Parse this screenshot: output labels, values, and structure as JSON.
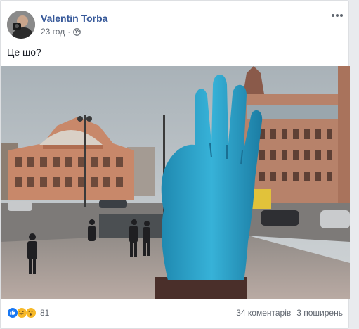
{
  "post": {
    "author": "Valentin Torba",
    "time": "23 год",
    "privacy_icon": "globe-icon",
    "text": "Це шо?"
  },
  "reactions": {
    "icons": [
      "like-icon",
      "haha-icon",
      "wow-icon"
    ],
    "count": "81"
  },
  "stats": {
    "comments": "34 коментарів",
    "shares": "3 поширень"
  },
  "colors": {
    "author_link": "#365899",
    "meta_text": "#616770",
    "like": "#1877f2",
    "emoji": "#f7b928",
    "sculpture": "#2fa3c9"
  }
}
